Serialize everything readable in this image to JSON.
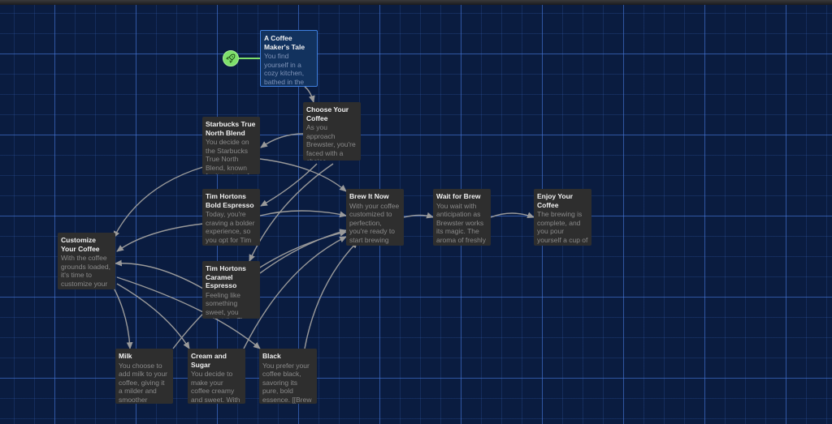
{
  "story_map": {
    "start_icon": "rocket-icon",
    "passages": [
      {
        "id": "tale",
        "title": "A Coffee Maker's Tale",
        "excerpt": "You find yourself in a cozy kitchen, bathed in the warm morning"
      },
      {
        "id": "choose",
        "title": "Choose Your Coffee",
        "excerpt": "As you approach Brewster, you're faced with a choice"
      },
      {
        "id": "starbucks",
        "title": "Starbucks True North Blend",
        "excerpt": "You decide on the Starbucks True North Blend, known for its notes of"
      },
      {
        "id": "tim-bold",
        "title": "Tim Hortons Bold Espresso",
        "excerpt": "Today, you're craving a bolder experience, so you opt for Tim"
      },
      {
        "id": "tim-caramel",
        "title": "Tim Hortons Caramel Espresso",
        "excerpt": "Feeling like something sweet, you select the Tim"
      },
      {
        "id": "customize",
        "title": "Customize Your Coffee",
        "excerpt": "With the coffee grounds loaded, it's time to customize your"
      },
      {
        "id": "brew",
        "title": "Brew It Now",
        "excerpt": "With your coffee customized to perfection, you're ready to start brewing"
      },
      {
        "id": "wait",
        "title": "Wait for Brew",
        "excerpt": "You wait with anticipation as Brewster works its magic. The aroma of freshly brewed"
      },
      {
        "id": "enjoy",
        "title": "Enjoy Your Coffee",
        "excerpt": "The brewing is complete, and you pour yourself a cup of the freshly"
      },
      {
        "id": "milk",
        "title": "Milk",
        "excerpt": "You choose to add milk to your coffee, giving it a milder and smoother"
      },
      {
        "id": "cream",
        "title": "Cream and Sugar",
        "excerpt": "You decide to make your coffee creamy and sweet. With care, you"
      },
      {
        "id": "black",
        "title": "Black",
        "excerpt": "You prefer your coffee black, savoring its pure, bold essence. [[Brew It Now]]"
      }
    ]
  },
  "colors": {
    "background": "#0a1c40",
    "grid": "#4678dc",
    "passage": "#2e2e2e",
    "start_passage": "#12325e",
    "start_marker": "#7ee06b",
    "link_arrow": "#9a9a9a"
  }
}
